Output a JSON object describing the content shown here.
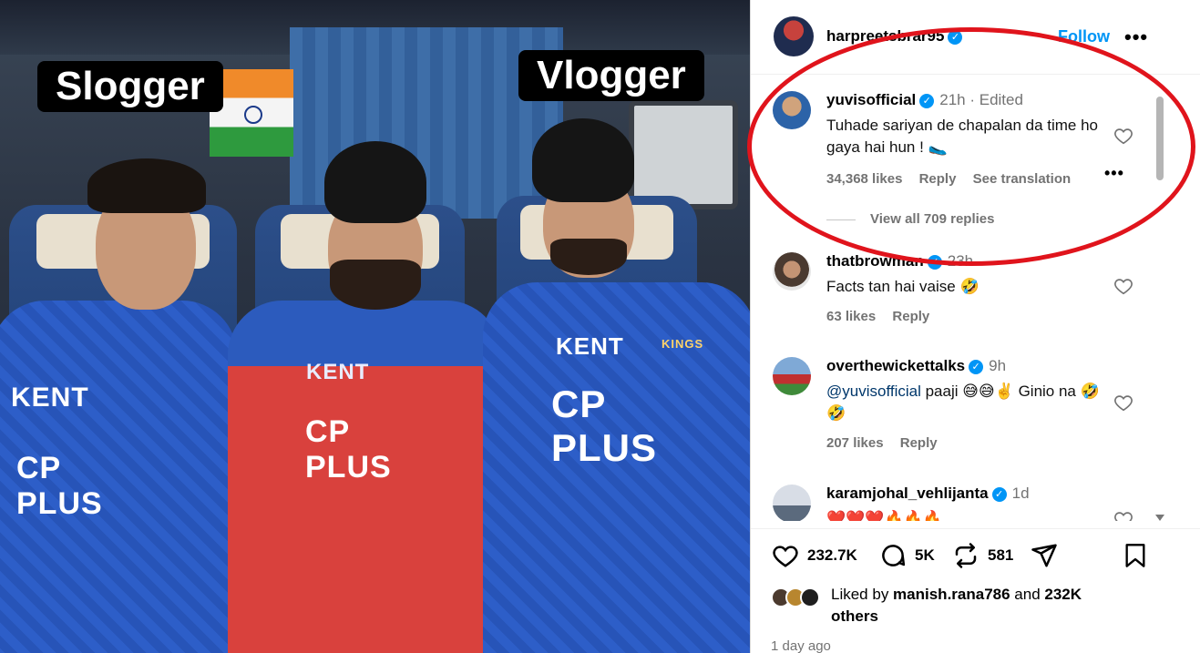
{
  "post": {
    "owner_username": "harpreetsbrar95",
    "follow_label": "Follow",
    "more_label": "•••",
    "photo": {
      "caption_left": "Slogger",
      "caption_right": "Vlogger",
      "jersey_brand": "KENT",
      "jersey_sponsor": "CP PLUS",
      "jersey_team": "KINGS"
    }
  },
  "comments": [
    {
      "username": "yuvisofficial",
      "time": "21h · Edited",
      "text": "Tuhade sariyan de chapalan da time ho gaya hai hun ! 🥿",
      "likes": "34,368 likes",
      "reply_label": "Reply",
      "translation_label": "See translation",
      "more_label": "•••",
      "view_replies": "View all 709 replies"
    },
    {
      "username": "thatbrowman",
      "time": "23h",
      "text": "Facts tan hai vaise 🤣",
      "likes": "63 likes",
      "reply_label": "Reply"
    },
    {
      "username": "overthewickettalks",
      "time": "9h",
      "mention": "@yuvisofficial",
      "text": " paaji 😅😅✌️ Ginio na 🤣🤣",
      "likes": "207 likes",
      "reply_label": "Reply"
    },
    {
      "username": "karamjohal_vehlijanta",
      "time": "1d",
      "text": "❤️❤️❤️🔥🔥🔥"
    }
  ],
  "actions": {
    "likes_count": "232.7K",
    "comments_count": "5K",
    "reposts_count": "581"
  },
  "liked_by": {
    "prefix": "Liked by ",
    "user": "manish.rana786",
    "middle": " and ",
    "count": "232K",
    "suffix": " others"
  },
  "timestamp": "1 day ago",
  "colors": {
    "accent": "#0095f6",
    "annotation_oval": "#e0141c",
    "verified": "#0095f6"
  }
}
